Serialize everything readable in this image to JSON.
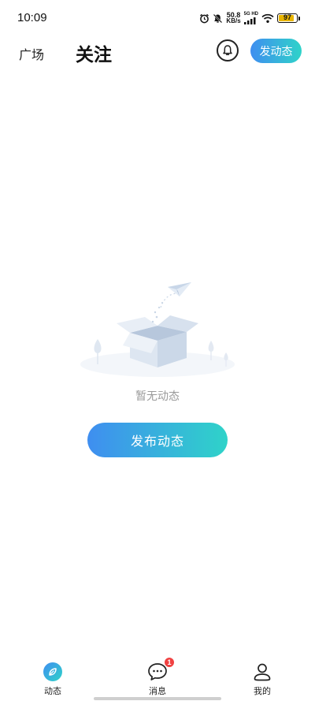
{
  "status_bar": {
    "time": "10:09",
    "net_speed_value": "50.8",
    "net_speed_unit": "KB/s",
    "signal_label": "5G HD",
    "battery_level": "97",
    "battery_color": "#e9b500"
  },
  "header": {
    "tab_square": "广场",
    "tab_follow": "关注",
    "bell_icon": "bell-icon",
    "post_button": "发动态"
  },
  "empty_state": {
    "message": "暂无动态",
    "publish_button": "发布动态",
    "illustration": "empty-box-with-paper-plane"
  },
  "bottom_nav": {
    "items": [
      {
        "label": "动态",
        "icon": "compass-leaf-icon",
        "active": true
      },
      {
        "label": "消息",
        "icon": "chat-bubble-icon",
        "badge": "1"
      },
      {
        "label": "我的",
        "icon": "user-icon"
      }
    ]
  },
  "colors": {
    "accent_start": "#3f8ef0",
    "accent_end": "#2fd3c9",
    "badge": "#f04141",
    "muted_text": "#9a9a9a"
  }
}
